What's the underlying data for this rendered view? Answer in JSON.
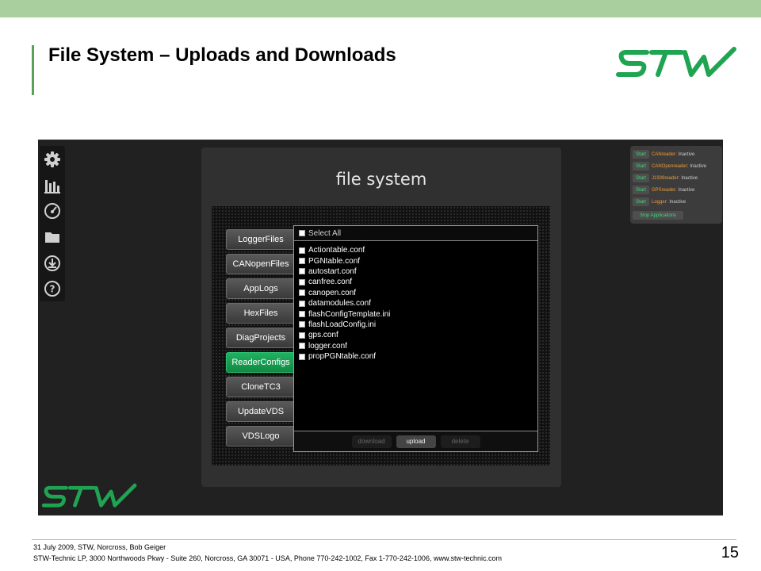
{
  "slide": {
    "title": "File System – Uploads and Downloads",
    "page_number": "15",
    "footer_line1": "31 July 2009, STW, Norcross, Bob Geiger",
    "footer_line2": "STW-Technic LP, 3000 Northwoods Pkwy - Suite 260, Norcross, GA 30071 - USA, Phone 770-242-1002, Fax 1-770-242-1006, www.stw-technic.com",
    "logo_text": "STW"
  },
  "nav": {
    "icons": [
      "gear-icon",
      "bar-chart-icon",
      "gauge-icon",
      "folder-icon",
      "download-icon",
      "help-icon"
    ]
  },
  "panel": {
    "title": "file system",
    "folders": [
      "LoggerFiles",
      "CANopenFiles",
      "AppLogs",
      "HexFiles",
      "DiagProjects",
      "ReaderConfigs",
      "CloneTC3",
      "UpdateVDS",
      "VDSLogo"
    ],
    "selected_folder": "ReaderConfigs",
    "select_all_label": "Select All",
    "files": [
      "Actiontable.conf",
      "PGNtable.conf",
      "autostart.conf",
      "canfree.conf",
      "canopen.conf",
      "datamodules.conf",
      "flashConfigTemplate.ini",
      "flashLoadConfig.ini",
      "gps.conf",
      "logger.conf",
      "propPGNtable.conf"
    ],
    "actions": {
      "download": "download",
      "upload": "upload",
      "delete": "delete"
    }
  },
  "readers": {
    "start_label": "Start",
    "items": [
      {
        "name": "CANreader:",
        "status": "Inactive"
      },
      {
        "name": "CANOpenreader:",
        "status": "Inactive"
      },
      {
        "name": "J1939reader:",
        "status": "Inactive"
      },
      {
        "name": "GPSreader:",
        "status": "Inactive"
      },
      {
        "name": "Logger:",
        "status": "Inactive"
      }
    ],
    "stop_label": "Stop Applications"
  },
  "colors": {
    "brand_green": "#1fa552",
    "active_button": "#16a050",
    "reader_name": "#f09a3a",
    "start_text": "#3fd97a"
  }
}
